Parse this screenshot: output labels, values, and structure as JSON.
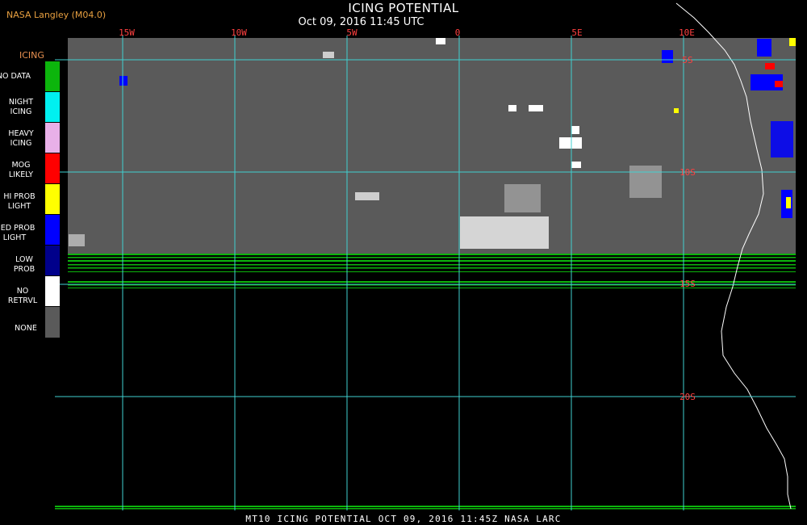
{
  "header": {
    "title": "ICING POTENTIAL",
    "subtitle": "Oct 09, 2016 11:45 UTC",
    "agency": "NASA Langley (M04.0)"
  },
  "legend": {
    "heading": "ICING",
    "items": [
      {
        "label": "NO DATA",
        "color": "#0cb50c"
      },
      {
        "label": "NIGHT ICING",
        "color": "#00f0f0"
      },
      {
        "label": "HEAVY ICING",
        "color": "#e8b0e8"
      },
      {
        "label": "MOG LIKELY",
        "color": "#ff0000"
      },
      {
        "label": "HI PROB LIGHT",
        "color": "#ffff00"
      },
      {
        "label": "MED PROB LIGHT",
        "color": "#0000ff"
      },
      {
        "label": "LOW PROB",
        "color": "#00008b"
      },
      {
        "label": "NO RETRVL",
        "color": "#ffffff"
      },
      {
        "label": "NONE",
        "color": "#5a5a5a"
      }
    ]
  },
  "map": {
    "longitude_labels": [
      "15W",
      "10W",
      "5W",
      "0",
      "5E",
      "10E"
    ],
    "latitude_labels": [
      "5S",
      "10S",
      "15S",
      "20S"
    ],
    "grid_color": "#40d0d0",
    "label_color": "#ff4040",
    "coastline_color": "#ffffff"
  },
  "footer": {
    "text": "MT10  ICING POTENTIAL   OCT 09, 2016 11:45Z   NASA LARC"
  }
}
